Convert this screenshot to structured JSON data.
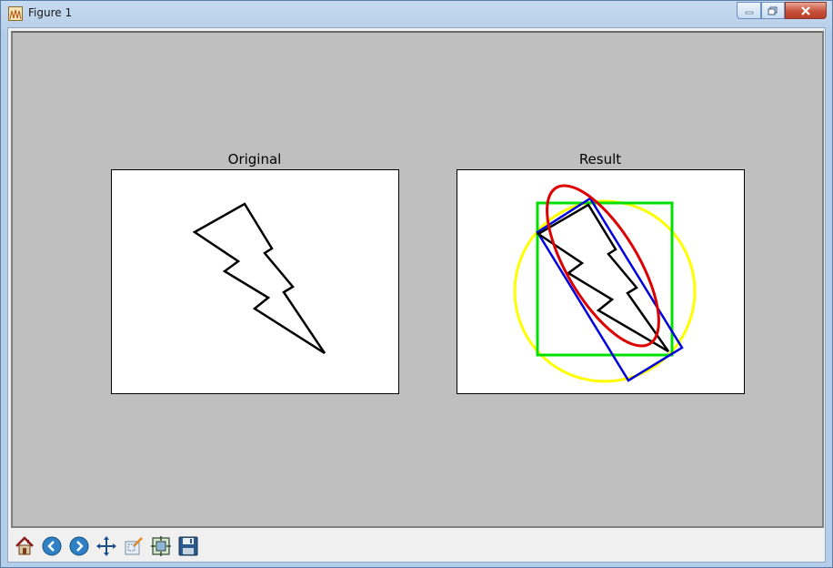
{
  "window": {
    "title": "Figure 1",
    "icon": "matplotlib-figure-icon",
    "controls": [
      "minimize-icon",
      "maximize-icon",
      "close-icon"
    ]
  },
  "figure": {
    "axes": [
      {
        "title": "Original",
        "content": "lightning-bolt outline"
      },
      {
        "title": "Result",
        "content": "lightning-bolt outline with bounding shapes"
      }
    ],
    "colors": {
      "background": "#bfbfbf",
      "bolt": "#000000",
      "bounding_rect": "#00ff00",
      "min_area_rect": "#0000ff",
      "min_enclosing_circle": "#ffff00",
      "fitted_ellipse": "#ff0000"
    }
  },
  "toolbar": {
    "buttons": [
      {
        "name": "home",
        "icon": "home-icon"
      },
      {
        "name": "back",
        "icon": "back-arrow-icon"
      },
      {
        "name": "forward",
        "icon": "forward-arrow-icon"
      },
      {
        "name": "pan",
        "icon": "pan-arrows-icon"
      },
      {
        "name": "zoom",
        "icon": "zoom-rect-icon"
      },
      {
        "name": "subplots",
        "icon": "subplots-icon"
      },
      {
        "name": "save",
        "icon": "floppy-disk-icon"
      }
    ]
  }
}
